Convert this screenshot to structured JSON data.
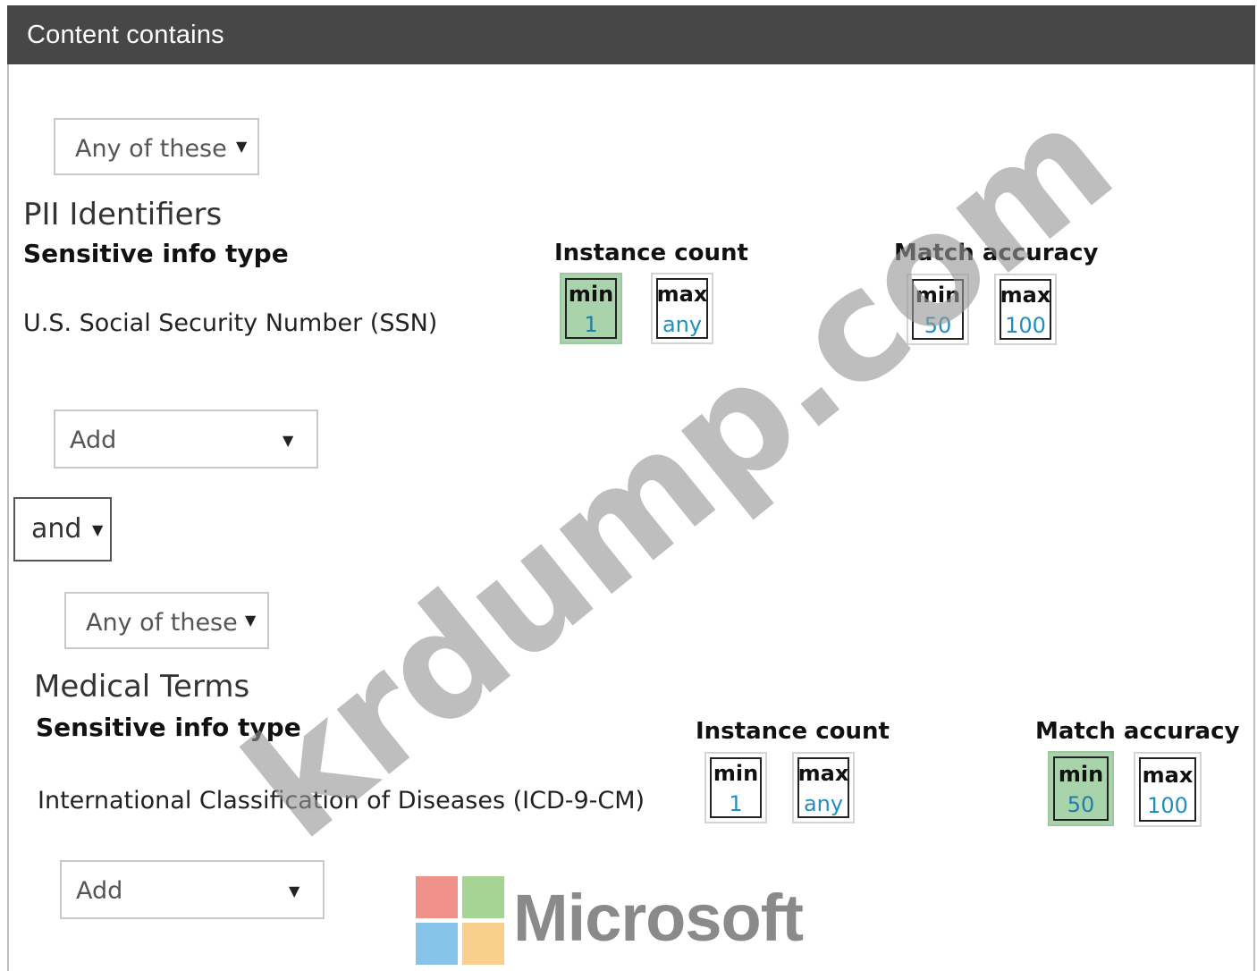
{
  "header": {
    "title": "Content contains"
  },
  "groups": [
    {
      "selector": "Any of these",
      "title": "PII Identifiers",
      "col_info_type": "Sensitive info type",
      "col_instance": "Instance count",
      "col_accuracy": "Match accuracy",
      "info_type": "U.S. Social Security Number (SSN)",
      "instance": {
        "min_label": "min",
        "min_value": "1",
        "max_label": "max",
        "max_value": "any"
      },
      "accuracy": {
        "min_label": "min",
        "min_value": "50",
        "max_label": "max",
        "max_value": "100"
      },
      "add_label": "Add"
    },
    {
      "selector": "Any of these",
      "title": "Medical Terms",
      "col_info_type": "Sensitive info type",
      "col_instance": "Instance count",
      "col_accuracy": "Match accuracy",
      "info_type": "International Classification of Diseases (ICD-9-CM)",
      "instance": {
        "min_label": "min",
        "min_value": "1",
        "max_label": "max",
        "max_value": "any"
      },
      "accuracy": {
        "min_label": "min",
        "min_value": "50",
        "max_label": "max",
        "max_value": "100"
      },
      "add_label": "Add"
    }
  ],
  "operator": {
    "label": "and"
  },
  "watermark": "krdump.com",
  "logo": {
    "word": "Microsoft",
    "colors": [
      "#f0928a",
      "#a6d494",
      "#86c4ea",
      "#f8cf8c"
    ]
  },
  "colors": {
    "header_bg": "#474747",
    "highlight": "#a9d3ab",
    "value_blue": "#1f8fbf"
  },
  "icons": [
    "caret-down-icon"
  ]
}
